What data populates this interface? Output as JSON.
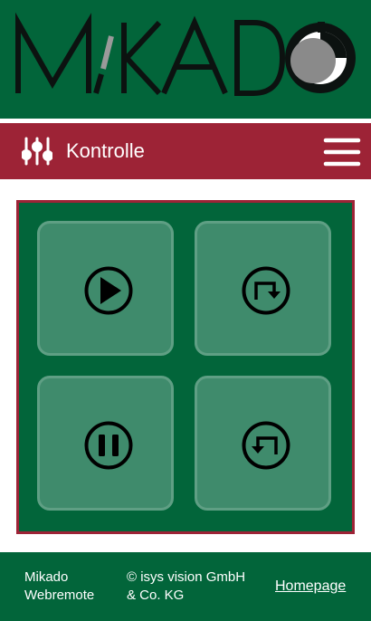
{
  "header": {
    "logo_text": "MiKADO",
    "logo_icon": "circular-dial-logo"
  },
  "nav": {
    "title": "Kontrolle",
    "left_icon": "sliders-icon",
    "menu_icon": "hamburger-menu-icon"
  },
  "controls": [
    {
      "icon": "play-icon"
    },
    {
      "icon": "loop-forward-icon"
    },
    {
      "icon": "pause-icon"
    },
    {
      "icon": "loop-back-icon"
    }
  ],
  "footer": {
    "app_name_line1": "Mikado",
    "app_name_line2": "Webremote",
    "copyright_line1": "© isys vision GmbH",
    "copyright_line2": "& Co. KG",
    "homepage_link": "Homepage"
  },
  "colors": {
    "green": "#02653a",
    "red": "#9d2336",
    "tile": "#3f8b6c",
    "tile_border": "#5f9f84",
    "white": "#ffffff"
  }
}
